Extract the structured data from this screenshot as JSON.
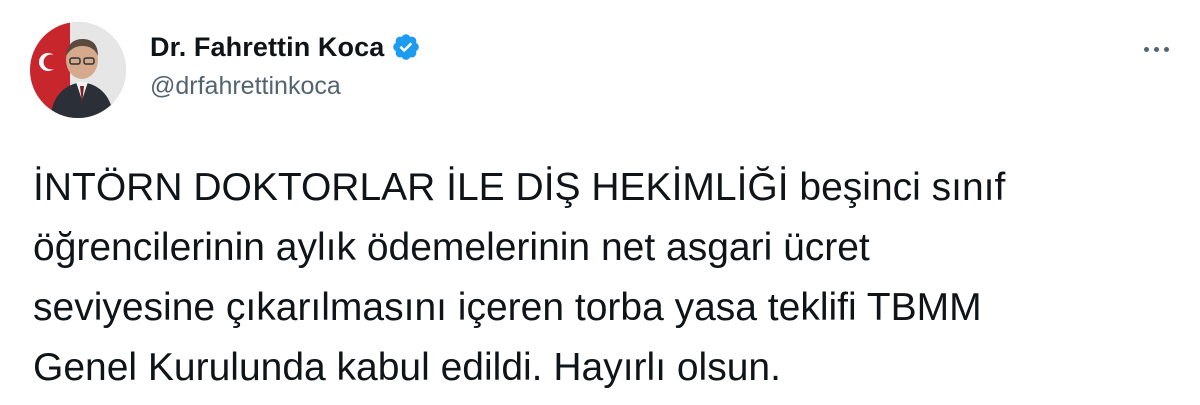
{
  "author": {
    "display_name": "Dr. Fahrettin Koca",
    "handle": "@drfahrettinkoca",
    "verified": true,
    "verified_icon": "verified-badge-icon",
    "avatar_icon": "profile-photo"
  },
  "actions": {
    "more_icon": "more-horizontal-icon"
  },
  "tweet": {
    "lines": [
      "İNTÖRN DOKTORLAR İLE DİŞ HEKİMLİĞİ beşinci sınıf",
      "öğrencilerinin aylık ödemelerinin net asgari ücret",
      "seviyesine çıkarılmasını içeren torba yasa teklifi TBMM",
      "Genel Kurulunda kabul edildi. Hayırlı olsun."
    ]
  },
  "colors": {
    "text_primary": "#0f1419",
    "text_secondary": "#536471",
    "verified_blue": "#1d9bf0",
    "background": "#ffffff"
  }
}
